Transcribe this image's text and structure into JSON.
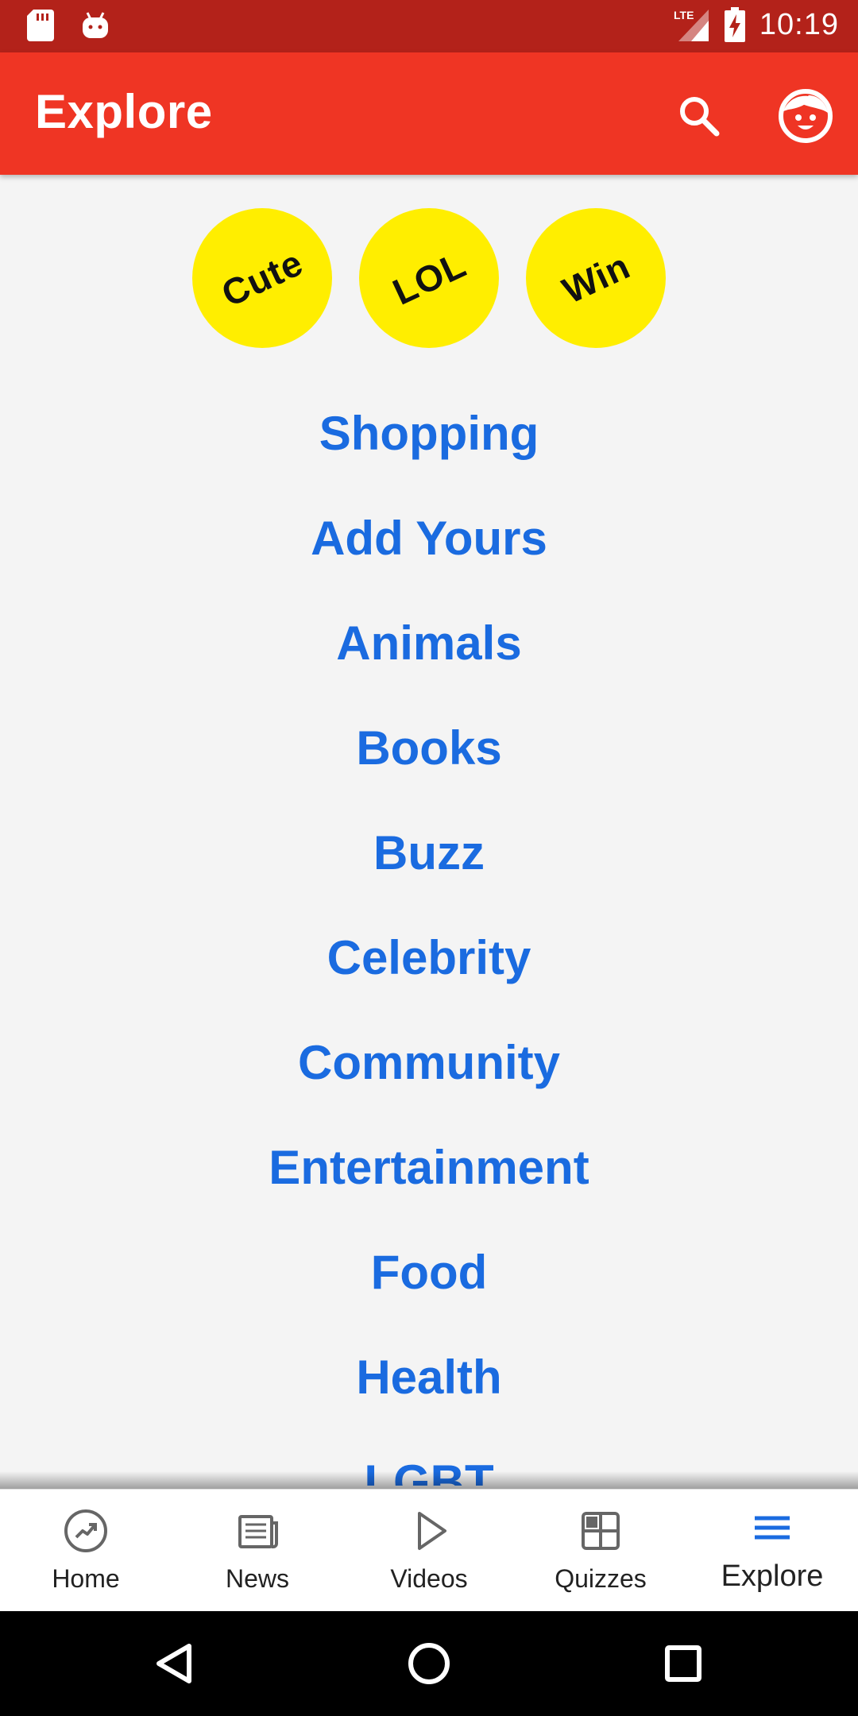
{
  "status_bar": {
    "time": "10:19",
    "network": "LTE",
    "left_icons": [
      "sd-card-icon",
      "android-debug-icon"
    ],
    "right_icons": [
      "lte-signal-icon",
      "battery-charging-icon"
    ]
  },
  "app_bar": {
    "title": "Explore",
    "color": "#ef3524",
    "actions": [
      "search-icon",
      "profile-face-icon"
    ]
  },
  "badges": [
    {
      "label": "Cute"
    },
    {
      "label": "LOL"
    },
    {
      "label": "Win"
    }
  ],
  "badge_color": "#ffee00",
  "categories": [
    "Shopping",
    "Add Yours",
    "Animals",
    "Books",
    "Buzz",
    "Celebrity",
    "Community",
    "Entertainment",
    "Food",
    "Health",
    "LGBT"
  ],
  "category_color": "#1a6be0",
  "bottom_nav": {
    "items": [
      {
        "label": "Home",
        "icon": "trending-icon"
      },
      {
        "label": "News",
        "icon": "newspaper-icon"
      },
      {
        "label": "Videos",
        "icon": "play-icon"
      },
      {
        "label": "Quizzes",
        "icon": "quiz-grid-icon"
      },
      {
        "label": "Explore",
        "icon": "menu-icon"
      }
    ],
    "active": "Explore",
    "active_color": "#1a6be0"
  },
  "system_nav": [
    "back-icon",
    "home-icon",
    "recents-icon"
  ]
}
